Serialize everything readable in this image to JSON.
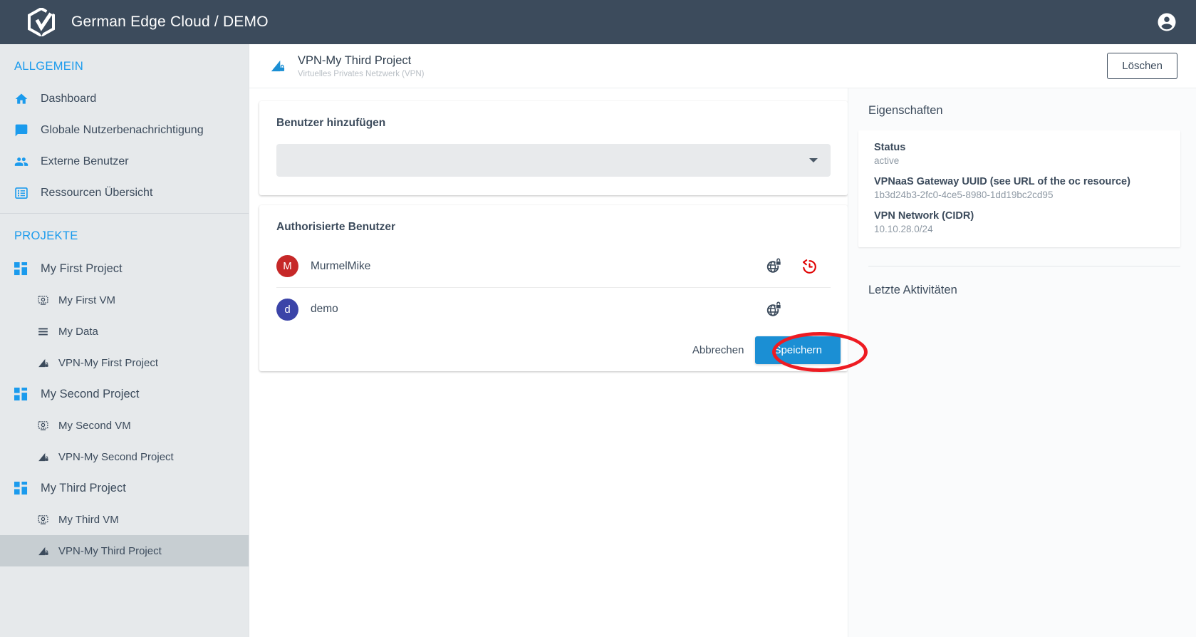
{
  "topbar": {
    "brand": "German Edge Cloud / DEMO",
    "logo_icon": "gec-hexagon-logo",
    "account_icon": "account-circle-icon"
  },
  "sidebar": {
    "sections": [
      {
        "title": "ALLGEMEIN",
        "items": [
          {
            "label": "Dashboard",
            "icon": "home-icon",
            "level": "top",
            "active": false
          },
          {
            "label": "Globale Nutzerbenachrichtigung",
            "icon": "chat-bubble-icon",
            "level": "top",
            "active": false
          },
          {
            "label": "Externe Benutzer",
            "icon": "people-icon",
            "level": "top",
            "active": false
          },
          {
            "label": "Ressourcen Übersicht",
            "icon": "list-box-icon",
            "level": "top",
            "active": false
          }
        ]
      },
      {
        "title": "PROJEKTE",
        "items": [
          {
            "label": "My First Project",
            "icon": "project-grid-icon",
            "level": "project",
            "active": false
          },
          {
            "label": "My First VM",
            "icon": "vm-icon",
            "level": "child",
            "active": false
          },
          {
            "label": "My Data",
            "icon": "data-list-icon",
            "level": "child",
            "active": false
          },
          {
            "label": "VPN-My First Project",
            "icon": "vpn-lock-icon",
            "level": "child",
            "active": false
          },
          {
            "label": "My Second Project",
            "icon": "project-grid-icon",
            "level": "project",
            "active": false
          },
          {
            "label": "My Second VM",
            "icon": "vm-icon",
            "level": "child",
            "active": false
          },
          {
            "label": "VPN-My Second Project",
            "icon": "vpn-lock-icon",
            "level": "child",
            "active": false
          },
          {
            "label": "My Third Project",
            "icon": "project-grid-icon",
            "level": "project",
            "active": false
          },
          {
            "label": "My Third VM",
            "icon": "vm-icon",
            "level": "child",
            "active": false
          },
          {
            "label": "VPN-My Third Project",
            "icon": "vpn-lock-icon",
            "level": "child",
            "active": true
          }
        ]
      }
    ]
  },
  "page_header": {
    "icon": "vpn-lock-icon",
    "title": "VPN-My Third Project",
    "subtitle": "Virtuelles Privates Netzwerk (VPN)",
    "delete_button": "Löschen"
  },
  "add_user_card": {
    "label": "Benutzer hinzufügen",
    "select_value": "",
    "select_placeholder": "",
    "caret_icon": "chevron-down-icon"
  },
  "authorized_users_card": {
    "label": "Authorisierte Benutzer",
    "users": [
      {
        "name": "MurmelMike",
        "initial": "M",
        "avatar_color": "#c62828",
        "actions": [
          {
            "icon": "globe-lock-icon",
            "color": "#3c4b5c"
          },
          {
            "icon": "history-restore-icon",
            "color": "#e00000"
          }
        ]
      },
      {
        "name": "demo",
        "initial": "d",
        "avatar_color": "#3b44a8",
        "actions": [
          {
            "icon": "globe-lock-icon",
            "color": "#3c4b5c"
          }
        ]
      }
    ],
    "cancel_label": "Abbrechen",
    "save_label": "Speichern"
  },
  "properties": {
    "title": "Eigenschaften",
    "rows": [
      {
        "key": "Status",
        "value": "active"
      },
      {
        "key": "VPNaaS Gateway UUID (see URL of the oc resource)",
        "value": "1b3d24b3-2fc0-4ce5-8980-1dd19bc2cd95"
      },
      {
        "key": "VPN Network (CIDR)",
        "value": "10.10.28.0/24"
      }
    ],
    "activities_title": "Letzte Aktivitäten"
  },
  "annotation": {
    "type": "red-ellipse-highlight",
    "target": "save-button",
    "color": "#ee1b22"
  },
  "colors": {
    "topbar": "#3c4b5c",
    "sidebar": "#e6e9eb",
    "accent_blue": "#1b9bed",
    "primary_button": "#1b8fd4",
    "highlight": "#ee1b22"
  }
}
